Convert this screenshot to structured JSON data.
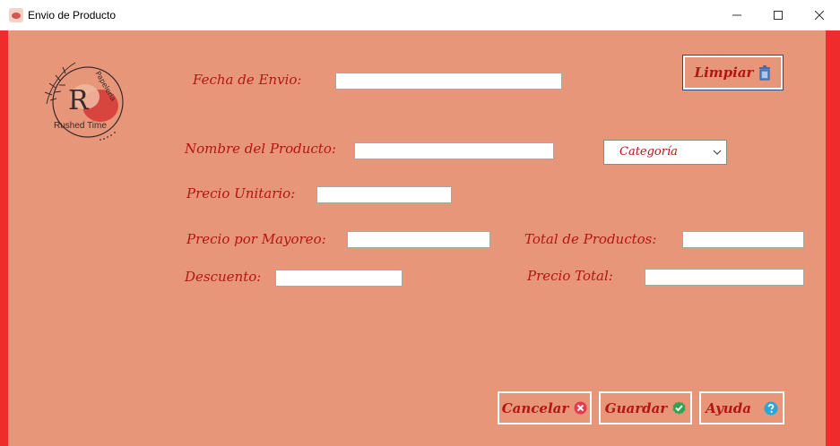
{
  "window": {
    "title": "Envio de Producto"
  },
  "logo": {
    "monogram": "R",
    "brand_top": "Papeleria",
    "brand_bottom": "Rushed Time"
  },
  "form": {
    "fecha_envio_label": "Fecha de Envio:",
    "fecha_envio_value": "",
    "nombre_producto_label": "Nombre del Producto:",
    "nombre_producto_value": "",
    "categoria_selected": "Categoría",
    "precio_unitario_label": "Precio Unitario:",
    "precio_unitario_value": "",
    "precio_mayoreo_label": "Precio por Mayoreo:",
    "precio_mayoreo_value": "",
    "total_productos_label": "Total de Productos:",
    "total_productos_value": "",
    "descuento_label": "Descuento:",
    "descuento_value": "",
    "precio_total_label": "Precio Total:",
    "precio_total_value": ""
  },
  "buttons": {
    "limpiar": "Limpiar",
    "cancelar": "Cancelar",
    "guardar": "Guardar",
    "ayuda": "Ayuda"
  },
  "colors": {
    "panel_bg": "#e79679",
    "frame": "#ef2b2b",
    "label_text": "#b41515"
  },
  "icons": {
    "limpiar": "trash-icon",
    "cancelar": "cancel-icon",
    "guardar": "check-icon",
    "ayuda": "help-icon"
  }
}
